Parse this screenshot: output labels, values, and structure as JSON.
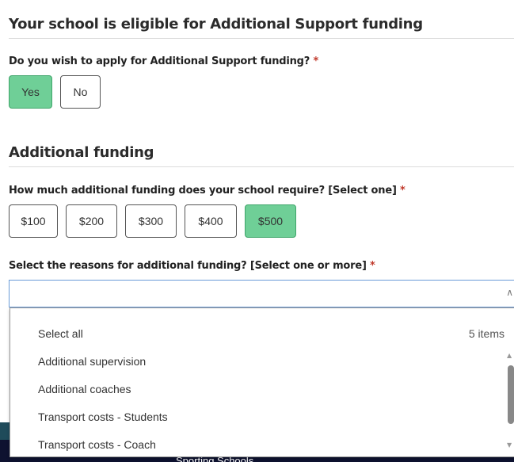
{
  "eligibility": {
    "heading": "Your school is eligible for Additional Support funding",
    "question": "Do you wish to apply for Additional Support funding?",
    "required_mark": "*",
    "options": [
      "Yes",
      "No"
    ],
    "selected": "Yes"
  },
  "funding": {
    "heading": "Additional funding",
    "question": "How much additional funding does your school require? [Select one]",
    "required_mark": "*",
    "options": [
      "$100",
      "$200",
      "$300",
      "$400",
      "$500"
    ],
    "selected": "$500"
  },
  "reasons": {
    "question": "Select the reasons for additional funding? [Select one or more]",
    "required_mark": "*",
    "value": "",
    "select_all": "Select all",
    "count": "5 items",
    "items": [
      "Additional supervision",
      "Additional coaches",
      "Transport costs - Students",
      "Transport costs - Coach"
    ]
  },
  "footer": {
    "brand": "Sporting Schools"
  },
  "colors": {
    "selected": "#6fcf97",
    "required": "#c0392b",
    "focus": "#6a9bd8"
  }
}
